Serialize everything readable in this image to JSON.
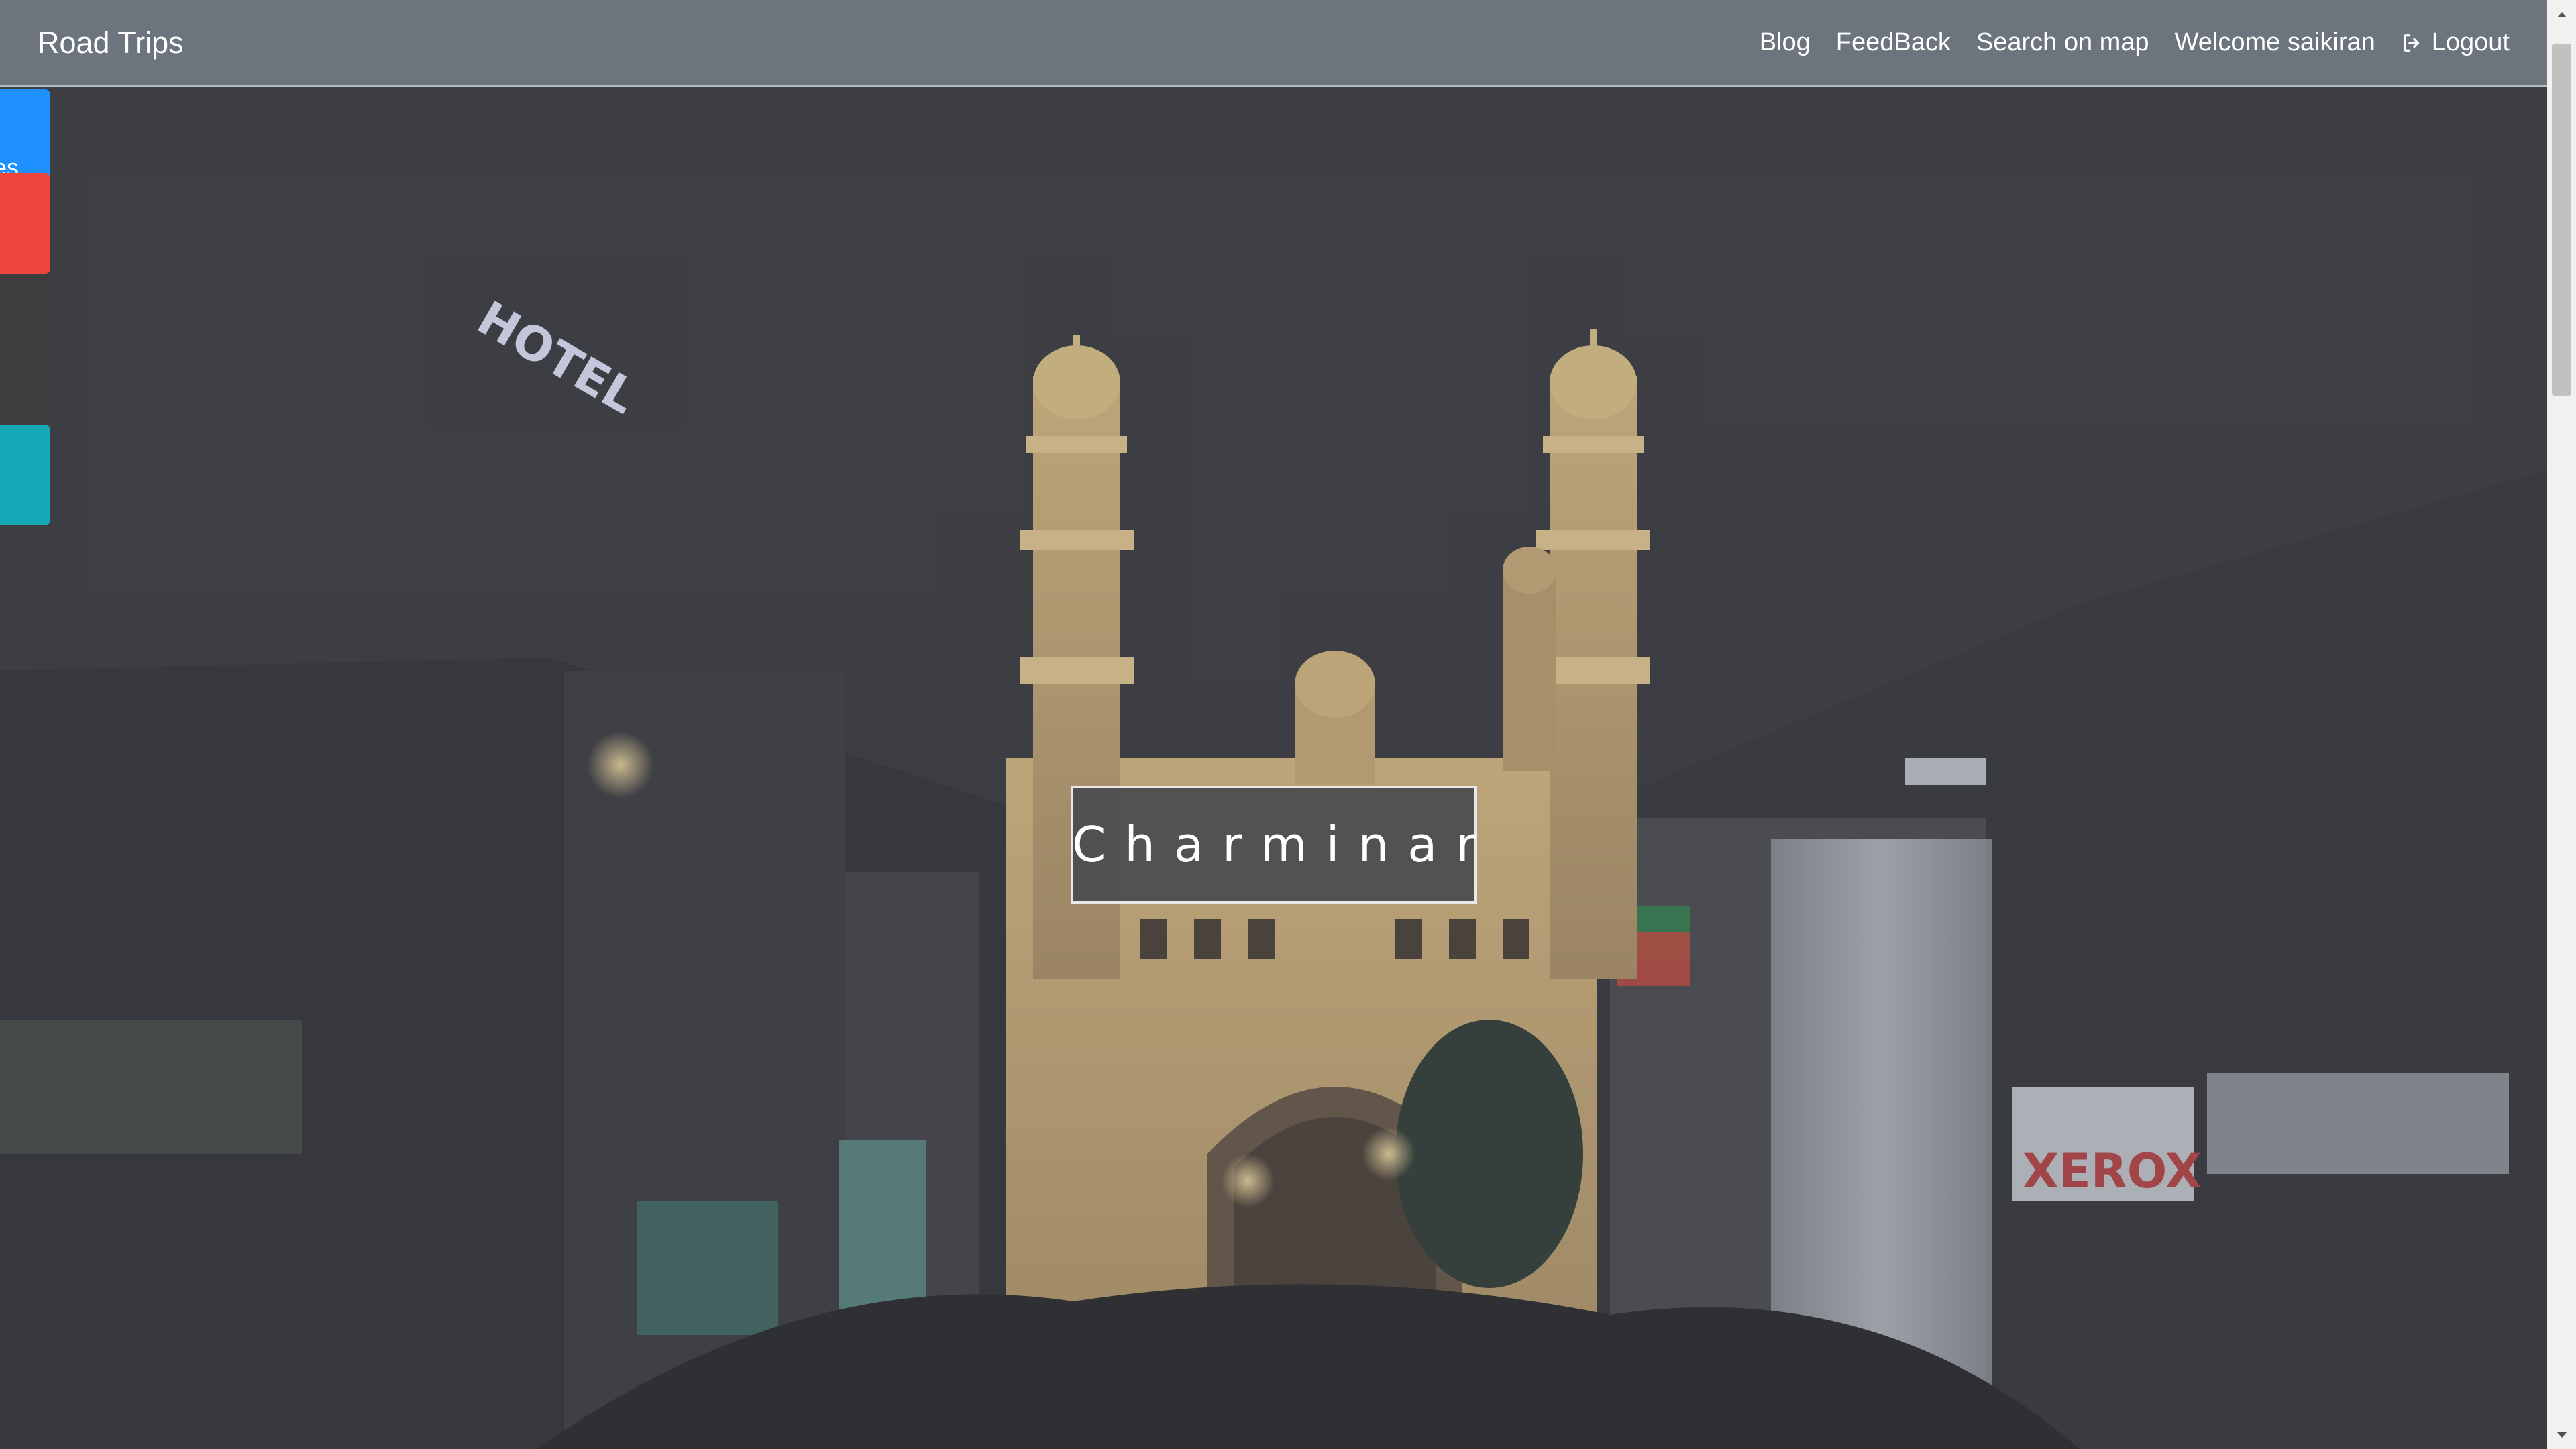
{
  "navbar": {
    "brand": "Road Trips",
    "links": {
      "blog": "Blog",
      "feedback": "FeedBack",
      "search_map": "Search on map",
      "welcome": "Welcome saikiran",
      "logout": "Logout"
    },
    "background_color": "#6c757d"
  },
  "side_tabs": {
    "blue_label": "ites",
    "blue_color": "#1e90ff",
    "red_color": "#f0443f",
    "dark_color": "#3d3d40",
    "teal_color": "#17a8b8"
  },
  "hero": {
    "title": "Charminar",
    "sign_hotel": "HOTEL",
    "sign_xerox": "XEROX"
  },
  "icons": {
    "logout": "sign-out-icon"
  }
}
